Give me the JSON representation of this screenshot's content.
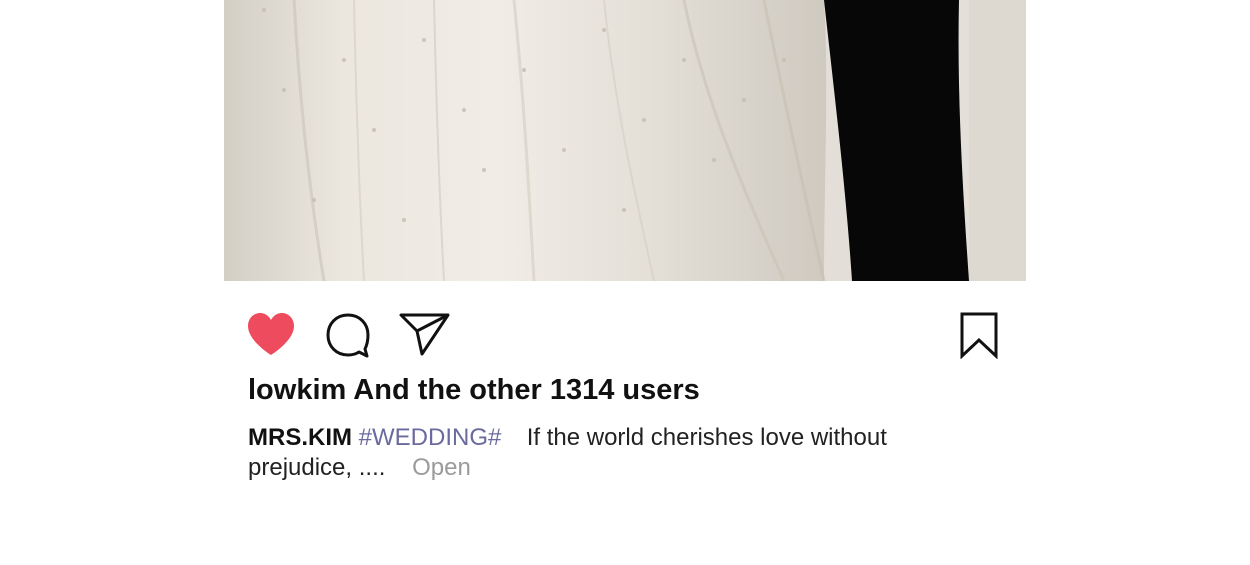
{
  "post": {
    "photo_alt": "Wedding dress photo",
    "actions": {
      "like_icon": "heart-filled-icon",
      "comment_icon": "speech-bubble-icon",
      "share_icon": "paper-plane-icon",
      "save_icon": "bookmark-icon",
      "like_color": "#ee4b5e"
    },
    "likes_text": "lowkim And the other 1314 users",
    "caption": {
      "author": "MRS.KIM",
      "hashtag": "#WEDDING#",
      "text_line1": "If the world cherishes love without",
      "text_line2": "prejudice, ....",
      "open_label": "Open"
    }
  }
}
